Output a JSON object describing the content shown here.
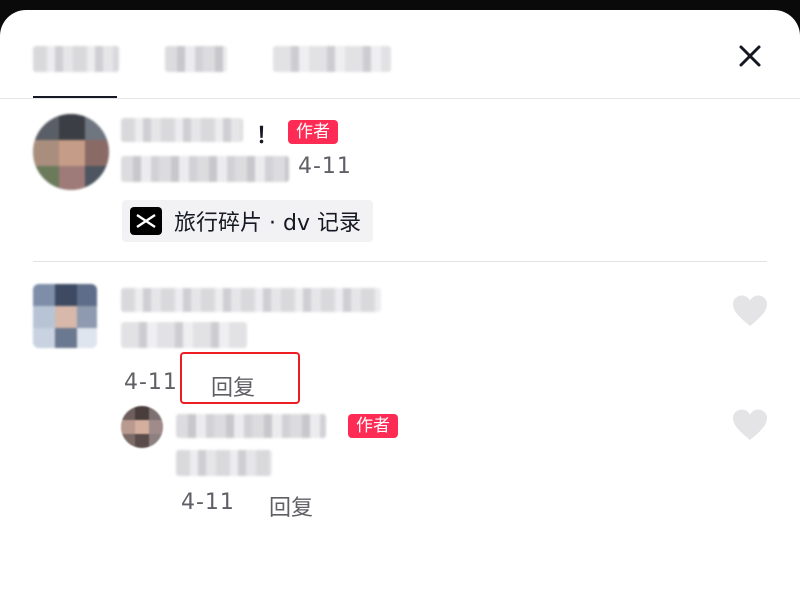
{
  "sheet": {
    "close_icon": "close-icon"
  },
  "comments": [
    {
      "exclaim": "！",
      "author_badge": "作者",
      "date": "4-11",
      "tag": {
        "icon": "capcut-icon",
        "label": "旅行碎片 · dv 记录"
      }
    },
    {
      "date": "4-11",
      "reply_label": "回复",
      "like_icon": "heart-icon",
      "replies": [
        {
          "author_badge": "作者",
          "date": "4-11",
          "reply_label": "回复",
          "like_icon": "heart-icon"
        }
      ]
    }
  ],
  "colors": {
    "badge": "#fe2c55",
    "highlight_box": "#ee1d23",
    "meta_text": "#5f5f66"
  }
}
